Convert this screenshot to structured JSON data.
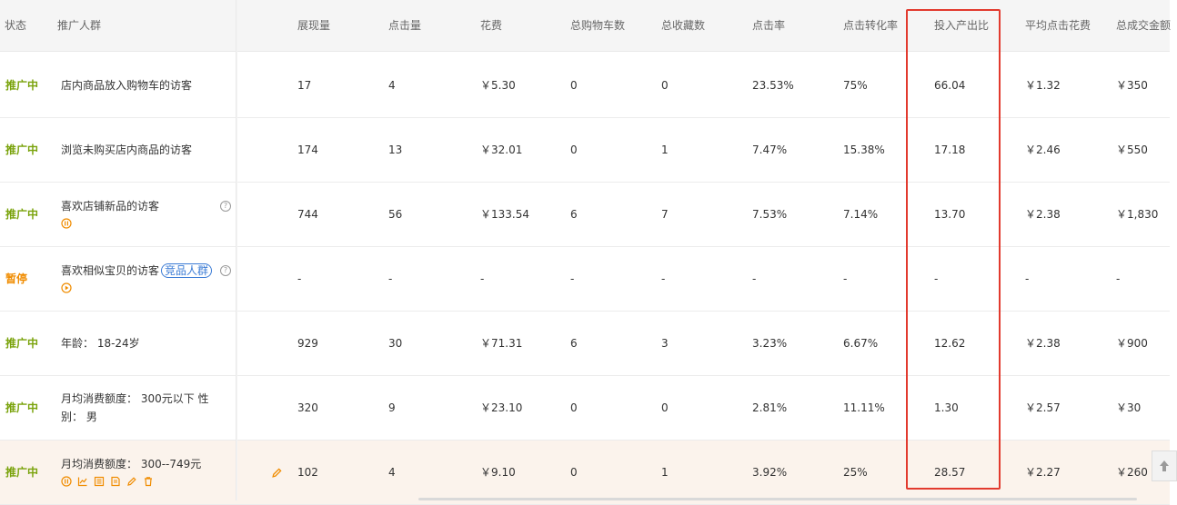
{
  "headers": {
    "status": "状态",
    "audience": "推广人群",
    "impressions": "展现量",
    "clicks": "点击量",
    "cost": "花费",
    "carts": "总购物车数",
    "favorites": "总收藏数",
    "ctr": "点击率",
    "cvr": "点击转化率",
    "roi": "投入产出比",
    "cpc": "平均点击花费",
    "gmv": "总成交金额"
  },
  "rows": [
    {
      "status": "推广中",
      "audience": "店内商品放入购物车的访客",
      "tag": "",
      "impressions": "17",
      "clicks": "4",
      "cost": "￥5.30",
      "carts": "0",
      "favorites": "0",
      "ctr": "23.53%",
      "cvr": "75%",
      "roi": "66.04",
      "cpc": "￥1.32",
      "gmv": "￥350"
    },
    {
      "status": "推广中",
      "audience": "浏览未购买店内商品的访客",
      "tag": "",
      "impressions": "174",
      "clicks": "13",
      "cost": "￥32.01",
      "carts": "0",
      "favorites": "1",
      "ctr": "7.47%",
      "cvr": "15.38%",
      "roi": "17.18",
      "cpc": "￥2.46",
      "gmv": "￥550"
    },
    {
      "status": "推广中",
      "audience": "喜欢店铺新品的访客",
      "tag": "",
      "impressions": "744",
      "clicks": "56",
      "cost": "￥133.54",
      "carts": "6",
      "favorites": "7",
      "ctr": "7.53%",
      "cvr": "7.14%",
      "roi": "13.70",
      "cpc": "￥2.38",
      "gmv": "￥1,830"
    },
    {
      "status": "暂停",
      "audience": "喜欢相似宝贝的访客",
      "tag": "竞品人群",
      "impressions": "-",
      "clicks": "-",
      "cost": "-",
      "carts": "-",
      "favorites": "-",
      "ctr": "-",
      "cvr": "-",
      "roi": "-",
      "cpc": "-",
      "gmv": "-"
    },
    {
      "status": "推广中",
      "audience": "年龄： 18-24岁",
      "tag": "",
      "impressions": "929",
      "clicks": "30",
      "cost": "￥71.31",
      "carts": "6",
      "favorites": "3",
      "ctr": "3.23%",
      "cvr": "6.67%",
      "roi": "12.62",
      "cpc": "￥2.38",
      "gmv": "￥900"
    },
    {
      "status": "推广中",
      "audience": "月均消费额度： 300元以下 性别： 男",
      "tag": "",
      "impressions": "320",
      "clicks": "9",
      "cost": "￥23.10",
      "carts": "0",
      "favorites": "0",
      "ctr": "2.81%",
      "cvr": "11.11%",
      "roi": "1.30",
      "cpc": "￥2.57",
      "gmv": "￥30"
    },
    {
      "status": "推广中",
      "audience": "月均消费额度： 300--749元",
      "tag": "",
      "impressions": "102",
      "clicks": "4",
      "cost": "￥9.10",
      "carts": "0",
      "favorites": "1",
      "ctr": "3.92%",
      "cvr": "25%",
      "roi": "28.57",
      "cpc": "￥2.27",
      "gmv": "￥260"
    }
  ],
  "colors": {
    "status_active": "#7aa30c",
    "status_paused": "#f08c00",
    "action_icon": "#f08c00",
    "highlight_box": "#e23a2e",
    "tag_blue": "#3a7bd5",
    "hover_row_bg": "#fbf3ec"
  },
  "icons": {
    "help": "question-circle-icon",
    "pause": "pause-circle-icon",
    "play": "play-circle-icon",
    "row_actions": [
      "pause-circle-icon",
      "line-chart-icon",
      "list-icon",
      "document-icon",
      "pencil-icon",
      "trash-icon"
    ],
    "edit_bid": "pencil-icon",
    "back_to_top": "arrow-up-icon"
  }
}
